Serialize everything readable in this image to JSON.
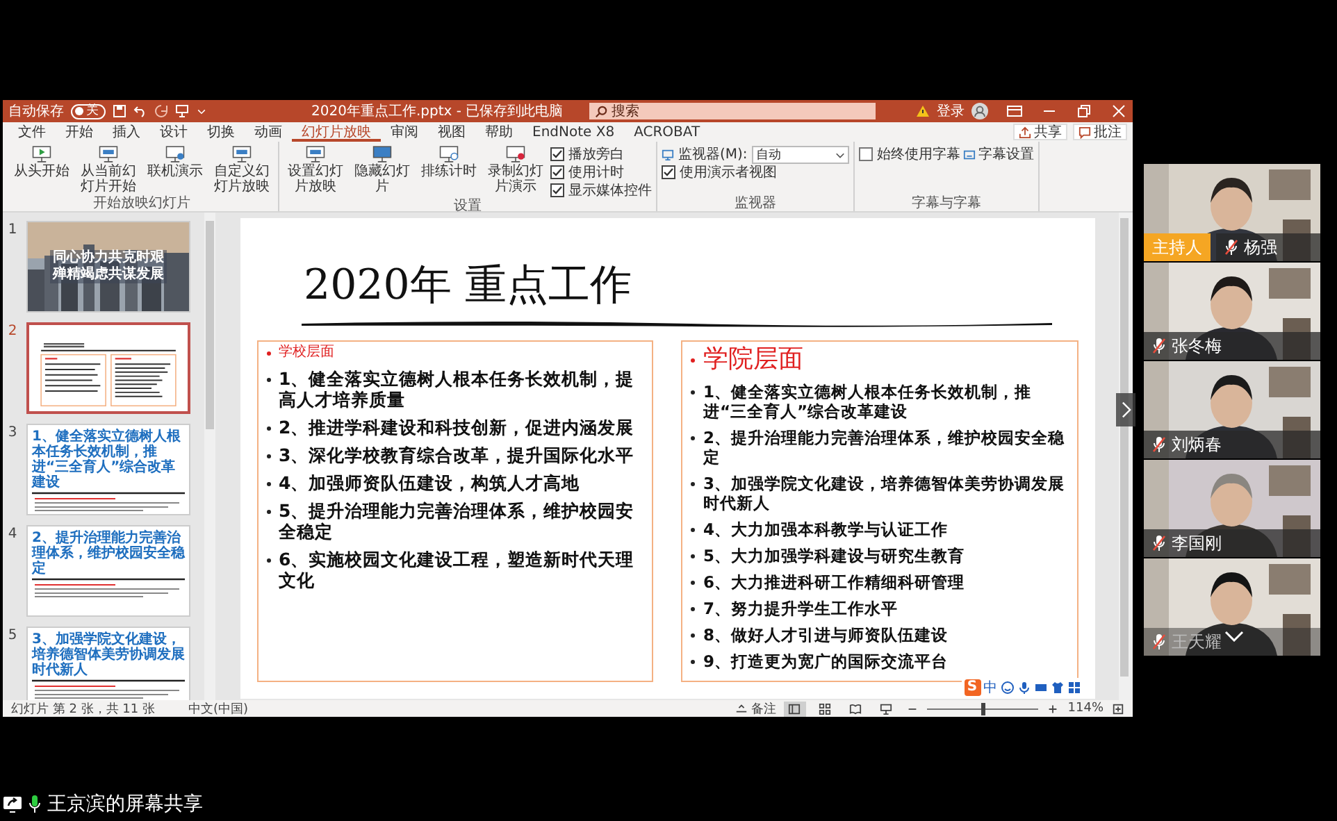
{
  "powerpoint": {
    "autosave": {
      "label": "自动保存",
      "on": false,
      "state_label": "关"
    },
    "title": "2020年重点工作.pptx - 已保存到此电脑",
    "search": {
      "placeholder": "搜索"
    },
    "account": "登录",
    "tabs": [
      {
        "label": "文件",
        "selected": false
      },
      {
        "label": "开始",
        "selected": false
      },
      {
        "label": "插入",
        "selected": false
      },
      {
        "label": "设计",
        "selected": false
      },
      {
        "label": "切换",
        "selected": false
      },
      {
        "label": "动画",
        "selected": false
      },
      {
        "label": "幻灯片放映",
        "selected": true
      },
      {
        "label": "审阅",
        "selected": false
      },
      {
        "label": "视图",
        "selected": false
      },
      {
        "label": "帮助",
        "selected": false
      },
      {
        "label": "EndNote X8",
        "selected": false
      },
      {
        "label": "ACROBAT",
        "selected": false
      }
    ],
    "share_button": "共享",
    "comments_button": "批注",
    "ribbon_groups": [
      {
        "label": "开始放映幻灯片",
        "items": [
          {
            "kind": "large",
            "label": "从头开始"
          },
          {
            "kind": "large",
            "label": "从当前幻灯片开始"
          },
          {
            "kind": "large",
            "label": "联机演示"
          },
          {
            "kind": "large",
            "label": "自定义幻灯片放映"
          }
        ]
      },
      {
        "label": "设置",
        "items": [
          {
            "kind": "large",
            "label": "设置幻灯片放映"
          },
          {
            "kind": "large",
            "label": "隐藏幻灯片"
          },
          {
            "kind": "large",
            "label": "排练计时"
          },
          {
            "kind": "large",
            "label": "录制幻灯片演示"
          },
          {
            "kind": "checks",
            "options": [
              {
                "label": "播放旁白",
                "checked": true
              },
              {
                "label": "使用计时",
                "checked": true
              },
              {
                "label": "显示媒体控件",
                "checked": true
              }
            ]
          }
        ]
      },
      {
        "label": "监视器",
        "items": [
          {
            "kind": "monitor",
            "label": "监视器(M):",
            "value": "自动",
            "option": {
              "label": "使用演示者视图",
              "checked": true
            }
          }
        ]
      },
      {
        "label": "字幕与字幕",
        "items": [
          {
            "kind": "checks",
            "options": [
              {
                "label": "始终使用字幕",
                "checked": false
              }
            ]
          },
          {
            "kind": "link",
            "label": "字幕设置"
          }
        ]
      }
    ],
    "slides": [
      {
        "number": "1",
        "selected": false,
        "kind": "cover",
        "title_lines": [
          "同心协力共克时艰",
          "殚精竭虑共谋发展"
        ]
      },
      {
        "number": "2",
        "selected": true,
        "kind": "preview"
      },
      {
        "number": "3",
        "selected": false,
        "kind": "text",
        "title": "1、健全落实立德树人根本任务长效机制，推进“三全育人”综合改革建设"
      },
      {
        "number": "4",
        "selected": false,
        "kind": "text",
        "title": "2、提升治理能力完善治理体系，维护校园安全稳定"
      },
      {
        "number": "5",
        "selected": false,
        "kind": "text",
        "title": "3、加强学院文化建设，培养德智体美劳协调发展时代新人"
      }
    ],
    "slide": {
      "title": "2020年 重点工作",
      "boxes": [
        {
          "kind": "small_heading",
          "heading": "学校层面",
          "items": [
            "1、健全落实立德树人根本任务长效机制，提高人才培养质量",
            "2、推进学科建设和科技创新，促进内涵发展",
            "3、深化学校教育综合改革，提升国际化水平",
            "4、加强师资队伍建设，构筑人才高地",
            "5、提升治理能力完善治理体系，维护校园安全稳定",
            "6、实施校园文化建设工程，塑造新时代天理文化"
          ]
        },
        {
          "kind": "large_heading",
          "heading": "学院层面",
          "items": [
            "1、健全落实立德树人根本任务长效机制，推进“三全育人”综合改革建设",
            "2、提升治理能力完善治理体系，维护校园安全稳定",
            "3、加强学院文化建设，培养德智体美劳协调发展时代新人",
            "4、大力加强本科教学与认证工作",
            "5、大力加强学科建设与研究生教育",
            "6、大力推进科研工作精细科研管理",
            "7、努力提升学生工作水平",
            "8、做好人才引进与师资队伍建设",
            "9、打造更为宽广的国际交流平台"
          ]
        }
      ]
    },
    "ime_bar": {
      "logo": "S",
      "mode": "中"
    },
    "status_bar": {
      "slide_info": "幻灯片 第 2 张，共 11 张",
      "language": "中文(中国)",
      "notes": "备注",
      "views": [
        {
          "kind": "normal",
          "selected": true
        },
        {
          "kind": "sorter",
          "selected": false
        },
        {
          "kind": "reading",
          "selected": false
        },
        {
          "kind": "slideshow",
          "selected": false
        }
      ],
      "zoom": {
        "level": 0.5
      },
      "zoom_label": "114%"
    }
  },
  "participants": [
    {
      "name": "杨强",
      "badge": "主持人",
      "muted": true,
      "dimmed": false
    },
    {
      "name": "张冬梅",
      "muted": true,
      "dimmed": false
    },
    {
      "name": "刘炳春",
      "muted": true,
      "dimmed": false
    },
    {
      "name": "李国刚",
      "muted": true,
      "dimmed": false
    },
    {
      "name": "王天耀",
      "muted": true,
      "dimmed": true
    }
  ],
  "screen_share": {
    "label": "王京滨的屏幕共享",
    "mic_active": true
  }
}
